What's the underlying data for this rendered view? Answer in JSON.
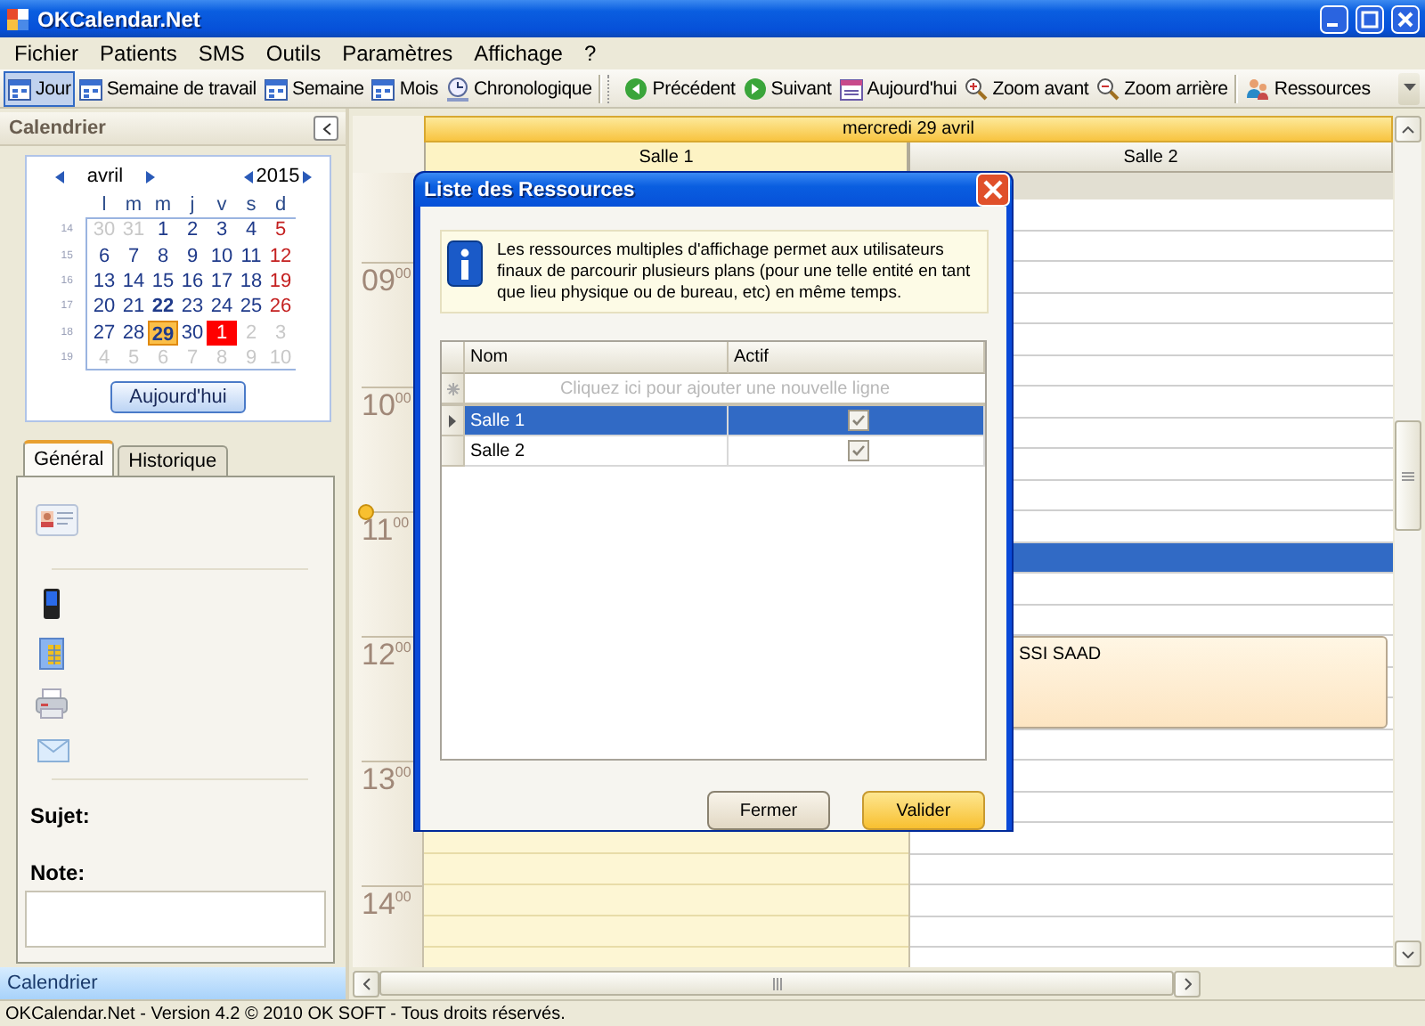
{
  "window": {
    "title": "OKCalendar.Net"
  },
  "menu": [
    "Fichier",
    "Patients",
    "SMS",
    "Outils",
    "Paramètres",
    "Affichage",
    "?"
  ],
  "toolbar": {
    "views": [
      {
        "label": "Jour",
        "kind": "view",
        "selected": true
      },
      {
        "label": "Semaine de travail",
        "kind": "view",
        "selected": false
      },
      {
        "label": "Semaine",
        "kind": "view",
        "selected": false
      },
      {
        "label": "Mois",
        "kind": "view",
        "selected": false
      },
      {
        "label": "Chronologique",
        "kind": "clock",
        "selected": false
      }
    ],
    "navigation": [
      {
        "label": "Précédent",
        "kind": "back"
      },
      {
        "label": "Suivant",
        "kind": "forward"
      },
      {
        "label": "Aujourd'hui",
        "kind": "today"
      },
      {
        "label": "Zoom avant",
        "kind": "zoomin"
      },
      {
        "label": "Zoom arrière",
        "kind": "zoomout"
      }
    ],
    "tools": [
      {
        "label": "Ressources",
        "kind": "people"
      }
    ]
  },
  "sidebar": {
    "title": "Calendrier",
    "calendar": {
      "month": "avril",
      "year": "2015",
      "weekdays": [
        "l",
        "m",
        "m",
        "j",
        "v",
        "s",
        "d"
      ],
      "weeks": [
        {
          "number": "14",
          "days": [
            {
              "n": "30",
              "kind": "other",
              "bold": false,
              "selected": false
            },
            {
              "n": "31",
              "kind": "other",
              "bold": false,
              "selected": false
            },
            {
              "n": "1",
              "kind": "day",
              "bold": false,
              "selected": false
            },
            {
              "n": "2",
              "kind": "day",
              "bold": false,
              "selected": false
            },
            {
              "n": "3",
              "kind": "day",
              "bold": false,
              "selected": false
            },
            {
              "n": "4",
              "kind": "day",
              "bold": false,
              "selected": false
            },
            {
              "n": "5",
              "kind": "sunday",
              "bold": false,
              "selected": false
            }
          ]
        },
        {
          "number": "15",
          "days": [
            {
              "n": "6",
              "kind": "day",
              "bold": false,
              "selected": false
            },
            {
              "n": "7",
              "kind": "day",
              "bold": false,
              "selected": false
            },
            {
              "n": "8",
              "kind": "day",
              "bold": false,
              "selected": false
            },
            {
              "n": "9",
              "kind": "day",
              "bold": false,
              "selected": false
            },
            {
              "n": "10",
              "kind": "day",
              "bold": false,
              "selected": false
            },
            {
              "n": "11",
              "kind": "day",
              "bold": false,
              "selected": false
            },
            {
              "n": "12",
              "kind": "sunday",
              "bold": false,
              "selected": false
            }
          ]
        },
        {
          "number": "16",
          "days": [
            {
              "n": "13",
              "kind": "day",
              "bold": false,
              "selected": false
            },
            {
              "n": "14",
              "kind": "day",
              "bold": false,
              "selected": false
            },
            {
              "n": "15",
              "kind": "day",
              "bold": false,
              "selected": false
            },
            {
              "n": "16",
              "kind": "day",
              "bold": false,
              "selected": false
            },
            {
              "n": "17",
              "kind": "day",
              "bold": false,
              "selected": false
            },
            {
              "n": "18",
              "kind": "day",
              "bold": false,
              "selected": false
            },
            {
              "n": "19",
              "kind": "sunday",
              "bold": false,
              "selected": false
            }
          ]
        },
        {
          "number": "17",
          "days": [
            {
              "n": "20",
              "kind": "day",
              "bold": false,
              "selected": false
            },
            {
              "n": "21",
              "kind": "day",
              "bold": false,
              "selected": false
            },
            {
              "n": "22",
              "kind": "day",
              "bold": true,
              "selected": false
            },
            {
              "n": "23",
              "kind": "day",
              "bold": false,
              "selected": false
            },
            {
              "n": "24",
              "kind": "day",
              "bold": false,
              "selected": false
            },
            {
              "n": "25",
              "kind": "day",
              "bold": false,
              "selected": false
            },
            {
              "n": "26",
              "kind": "sunday",
              "bold": false,
              "selected": false
            }
          ]
        },
        {
          "number": "18",
          "days": [
            {
              "n": "27",
              "kind": "day",
              "bold": false,
              "selected": false
            },
            {
              "n": "28",
              "kind": "day",
              "bold": false,
              "selected": false
            },
            {
              "n": "29",
              "kind": "day",
              "bold": true,
              "selected": true
            },
            {
              "n": "30",
              "kind": "day",
              "bold": false,
              "selected": false
            },
            {
              "n": "1",
              "kind": "holiday",
              "bold": false,
              "selected": false
            },
            {
              "n": "2",
              "kind": "other",
              "bold": false,
              "selected": false
            },
            {
              "n": "3",
              "kind": "other",
              "bold": false,
              "selected": false
            }
          ]
        },
        {
          "number": "19",
          "days": [
            {
              "n": "4",
              "kind": "other",
              "bold": false,
              "selected": false
            },
            {
              "n": "5",
              "kind": "other",
              "bold": false,
              "selected": false
            },
            {
              "n": "6",
              "kind": "other",
              "bold": false,
              "selected": false
            },
            {
              "n": "7",
              "kind": "other",
              "bold": false,
              "selected": false
            },
            {
              "n": "8",
              "kind": "other",
              "bold": false,
              "selected": false
            },
            {
              "n": "9",
              "kind": "other",
              "bold": false,
              "selected": false
            },
            {
              "n": "10",
              "kind": "other",
              "bold": false,
              "selected": false
            }
          ]
        }
      ]
    },
    "today_button": "Aujourd'hui",
    "tabs": [
      {
        "label": "Général",
        "selected": true
      },
      {
        "label": "Historique",
        "selected": false
      }
    ],
    "subject_label": "Sujet:",
    "note_label": "Note:",
    "footer": "Calendrier"
  },
  "day_view": {
    "date": "mercredi 29 avril",
    "resources": [
      {
        "name": "Salle 1",
        "selected": true
      },
      {
        "name": "Salle 2",
        "selected": false
      }
    ],
    "hours": [
      {
        "hour": "09",
        "minutes": "00",
        "current": false
      },
      {
        "hour": "10",
        "minutes": "00",
        "current": false
      },
      {
        "hour": "11",
        "minutes": "00",
        "current": true
      },
      {
        "hour": "12",
        "minutes": "00",
        "current": false
      },
      {
        "hour": "13",
        "minutes": "00",
        "current": false
      },
      {
        "hour": "14",
        "minutes": "00",
        "current": false
      }
    ],
    "slots": [
      {
        "selected": false
      },
      {
        "selected": false
      },
      {
        "selected": false
      },
      {
        "selected": false
      },
      {
        "selected": false
      },
      {
        "selected": false
      },
      {
        "selected": false
      },
      {
        "selected": false
      },
      {
        "selected": false
      },
      {
        "selected": false
      },
      {
        "selected": false
      },
      {
        "selected": true
      },
      {
        "selected": false
      },
      {
        "selected": false
      },
      {
        "selected": false,
        "appointment": "SSI SAAD"
      },
      {
        "selected": false
      },
      {
        "selected": false
      },
      {
        "selected": false
      },
      {
        "selected": false
      },
      {
        "selected": false
      },
      {
        "selected": false
      },
      {
        "selected": false
      },
      {
        "selected": false
      },
      {
        "selected": false
      }
    ]
  },
  "dialog": {
    "title": "Liste des Ressources",
    "info": "Les ressources multiples d'affichage permet aux utilisateurs finaux de parcourir plusieurs plans (pour une telle entité en tant que lieu physique ou de bureau, etc) en même temps.",
    "columns": [
      "Nom",
      "Actif"
    ],
    "new_row_hint": "Cliquez ici pour ajouter une nouvelle ligne",
    "rows": [
      {
        "name": "Salle 1",
        "active": true,
        "selected": true
      },
      {
        "name": "Salle 2",
        "active": true,
        "selected": false
      }
    ],
    "buttons": [
      {
        "label": "Fermer",
        "kind": "default"
      },
      {
        "label": "Valider",
        "kind": "primary"
      }
    ]
  },
  "status_bar": "OKCalendar.Net - Version 4.2 © 2010 OK SOFT - Tous droits réservés."
}
